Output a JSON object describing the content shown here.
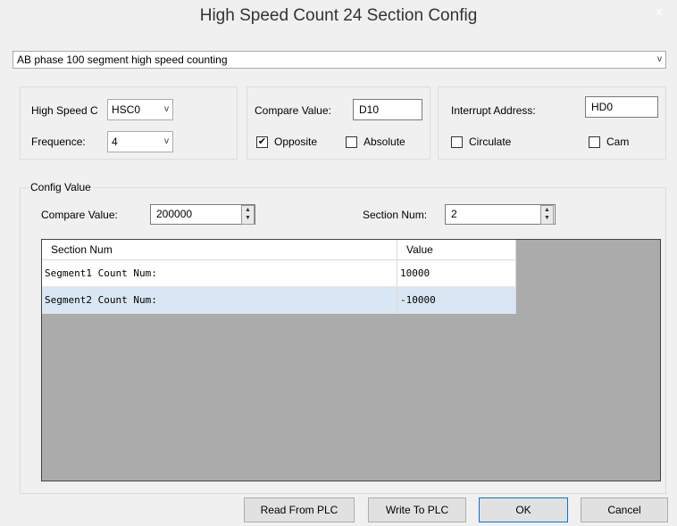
{
  "window": {
    "title": "High Speed Count 24 Section Config",
    "close_glyph": "×"
  },
  "mode": {
    "selected": "AB phase 100 segment high speed counting",
    "arrow": "v"
  },
  "group1": {
    "counter_label": "High Speed C",
    "counter_value": "HSC0",
    "frequence_label": "Frequence:",
    "frequence_value": "4",
    "arrow": "v"
  },
  "group2": {
    "compare_label": "Compare Value:",
    "compare_value": "D10",
    "opposite_label": "Opposite",
    "opposite_checked": "✔",
    "absolute_label": "Absolute",
    "absolute_checked": ""
  },
  "group3": {
    "interrupt_label": "Interrupt Address:",
    "interrupt_value": "HD0",
    "circulate_label": "Circulate",
    "cam_label": "Cam"
  },
  "config": {
    "legend": "Config Value",
    "compare_label": "Compare Value:",
    "compare_value": "200000",
    "section_label": "Section Num:",
    "section_value": "2",
    "spin_up": "▲",
    "spin_down": "▼"
  },
  "table": {
    "columns": [
      "Section Num",
      "Value"
    ],
    "rows": [
      {
        "name": "Segment1 Count Num:",
        "value": "10000",
        "selected": false
      },
      {
        "name": "Segment2 Count Num:",
        "value": "-10000",
        "selected": true
      }
    ]
  },
  "buttons": {
    "read": "Read From PLC",
    "write": "Write To PLC",
    "ok": "OK",
    "cancel": "Cancel"
  },
  "colors": {
    "selected_row": "#d9e6f3",
    "grid_bg": "#ababab",
    "ok_border": "#0078d7"
  }
}
